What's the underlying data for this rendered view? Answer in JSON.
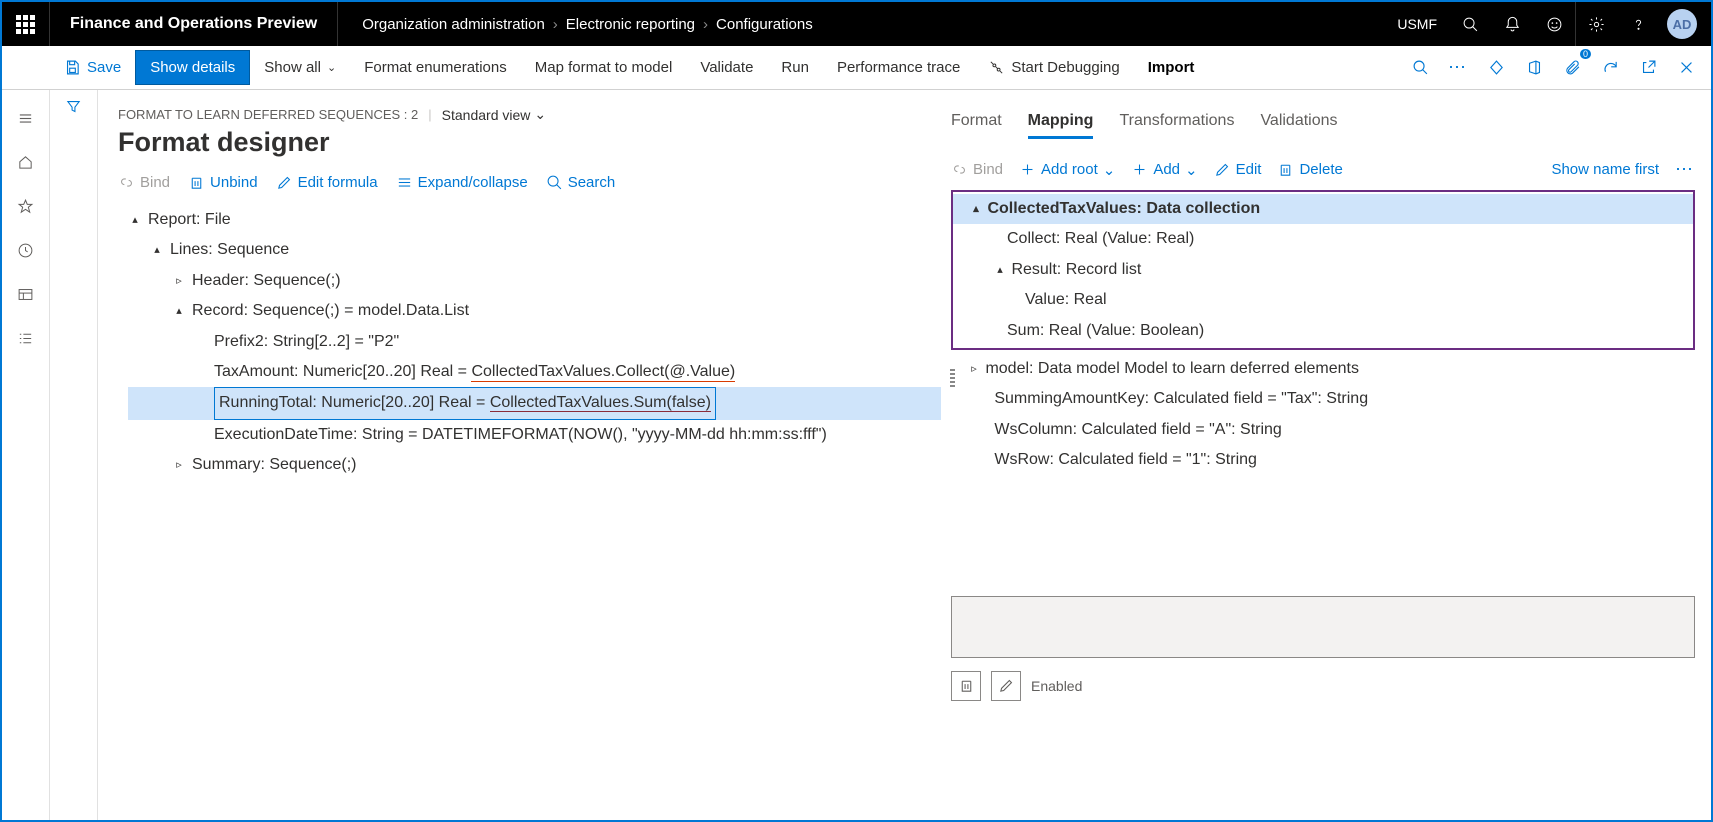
{
  "header": {
    "app_title": "Finance and Operations Preview",
    "breadcrumb": [
      "Organization administration",
      "Electronic reporting",
      "Configurations"
    ],
    "entity": "USMF",
    "avatar": "AD"
  },
  "cmdbar": {
    "save": "Save",
    "show_details": "Show details",
    "show_all": "Show all",
    "format_enum": "Format enumerations",
    "map_format": "Map format to model",
    "validate": "Validate",
    "run": "Run",
    "perf_trace": "Performance trace",
    "start_debug": "Start Debugging",
    "import": "Import"
  },
  "page": {
    "subtitle_text": "FORMAT TO LEARN DEFERRED SEQUENCES : 2",
    "view": "Standard view",
    "title": "Format designer"
  },
  "left_toolbar": {
    "bind": "Bind",
    "unbind": "Unbind",
    "edit_formula": "Edit formula",
    "expand": "Expand/collapse",
    "search": "Search"
  },
  "tree": {
    "n0": "Report: File",
    "n1": "Lines: Sequence",
    "n2": "Header: Sequence(;)",
    "n3": "Record: Sequence(;) = model.Data.List",
    "n4": "Prefix2: String[2..2] = \"P2\"",
    "n5_a": "TaxAmount: Numeric[20..20] Real = ",
    "n5_b": "CollectedTaxValues.Collect(@.Value)",
    "n6_a": "RunningTotal: Numeric[20..20] Real = ",
    "n6_b": "CollectedTaxValues.Sum(false)",
    "n7": "ExecutionDateTime: String = DATETIMEFORMAT(NOW(), \"yyyy-MM-dd hh:mm:ss:fff\")",
    "n8": "Summary: Sequence(;)"
  },
  "tabs": {
    "format": "Format",
    "mapping": "Mapping",
    "transformations": "Transformations",
    "validations": "Validations"
  },
  "right_toolbar": {
    "bind": "Bind",
    "add_root": "Add root",
    "add": "Add",
    "edit": "Edit",
    "delete": "Delete",
    "show_name": "Show name first"
  },
  "map_tree": {
    "m0": "CollectedTaxValues: Data collection",
    "m1": "Collect: Real (Value: Real)",
    "m2": "Result: Record list",
    "m3": "Value: Real",
    "m4": "Sum: Real (Value: Boolean)",
    "m5": "model: Data model Model to learn deferred elements",
    "m6": "SummingAmountKey: Calculated field = \"Tax\": String",
    "m7": "WsColumn: Calculated field = \"A\": String",
    "m8": "WsRow: Calculated field = \"1\": String"
  },
  "props": {
    "enabled_label": "Enabled"
  }
}
